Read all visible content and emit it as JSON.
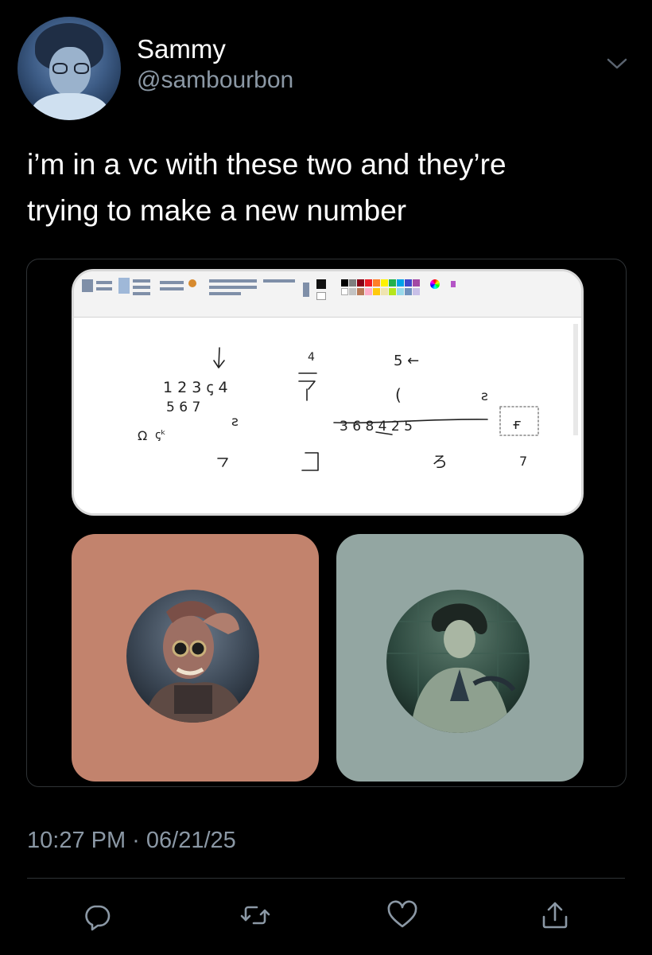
{
  "tweet": {
    "author": {
      "display_name": "Sammy",
      "handle": "@sambourbon"
    },
    "text_line_1": "i’m in a vc with these two and they’re",
    "text_line_2": "trying to make a new number",
    "timestamp": "10:27 PM · 06/21/25"
  },
  "media": {
    "paint_canvas": {
      "scribbles": [
        "↓",
        "1 2 3 ꞔ 4",
        "5 6 7",
        "ꙅ",
        "Ω",
        "ꞔᵏ",
        "ℸ",
        "4",
        "ᐁ",
        "5 ←",
        "(",
        "ꙅ",
        "3 6 8 4 2 5",
        "ғ",
        "⊐",
        "ろ",
        "7"
      ]
    },
    "participants": [
      {
        "tile_color": "#c2836d"
      },
      {
        "tile_color": "#93a6a2"
      }
    ]
  },
  "actions": {
    "icons": [
      "reply-icon",
      "retweet-icon",
      "like-icon",
      "share-icon"
    ]
  },
  "colors": {
    "background": "#000000",
    "secondary_text": "#8b98a5",
    "divider": "#2f3336"
  }
}
